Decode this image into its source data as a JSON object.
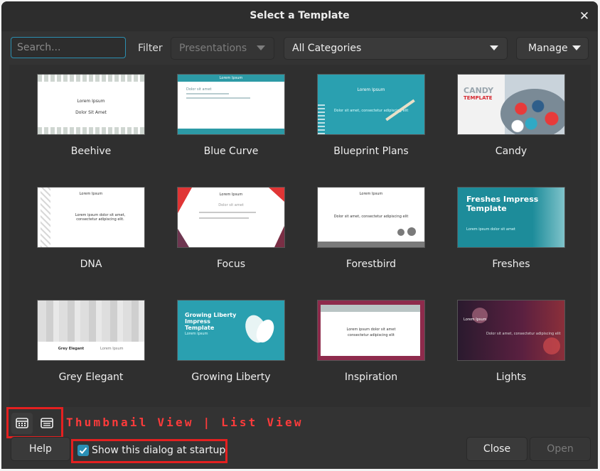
{
  "dialog": {
    "title": "Select a Template",
    "close_symbol": "✕"
  },
  "toolbar": {
    "search_placeholder": "Search...",
    "filter_label": "Filter",
    "filter_value": "Presentations",
    "category_value": "All Categories",
    "manage_label": "Manage"
  },
  "templates": [
    {
      "name": "Beehive",
      "line1": "Lorem Ipsum",
      "line2": "Dolor Sit Amet"
    },
    {
      "name": "Blue Curve",
      "line1": "Lorem Ipsum",
      "line2": "Dolor sit amet"
    },
    {
      "name": "Blueprint Plans",
      "line1": "Lorem Ipsum",
      "line2": "Dolor sit amet, consectetur adipiscing elit"
    },
    {
      "name": "Candy",
      "line1": "CANDY",
      "line2": "TEMPLATE"
    },
    {
      "name": "DNA",
      "line1": "Lorem Ipsum",
      "line2": "Lorem ipsum dolor sit amet, consectetur adipiscing elit."
    },
    {
      "name": "Focus",
      "line1": "Lorem Ipsum",
      "line2": "Dolor sit amet"
    },
    {
      "name": "Forestbird",
      "line1": "Lorem Ipsum",
      "line2": "Dolor sit amet, consectetur adipiscing elit"
    },
    {
      "name": "Freshes",
      "line1": "Freshes Impress Template",
      "line2": "Lorem ipsum dolor sit amet"
    },
    {
      "name": "Grey Elegant",
      "line1": "Grey Elegant",
      "line2": "Lorem Ipsum"
    },
    {
      "name": "Growing Liberty",
      "line1": "Growing Liberty Impress Template",
      "line2": "Lorem ipsum"
    },
    {
      "name": "Inspiration",
      "line1": "Lorem ipsum dolor sit amet",
      "line2": "consectetur adipiscing elit"
    },
    {
      "name": "Lights",
      "line1": "Lorem Ipsum",
      "line2": "Dolor sit amet, consectetur adipiscing elit"
    }
  ],
  "view_toggle": {
    "annotation": "Thumbnail View | List View"
  },
  "footer": {
    "help_label": "Help",
    "startup_checkbox_label": "Show this dialog at startup",
    "close_label": "Close",
    "open_label": "Open"
  },
  "colors": {
    "accent": "#2a8fb5",
    "annotation_red": "#e42020"
  }
}
